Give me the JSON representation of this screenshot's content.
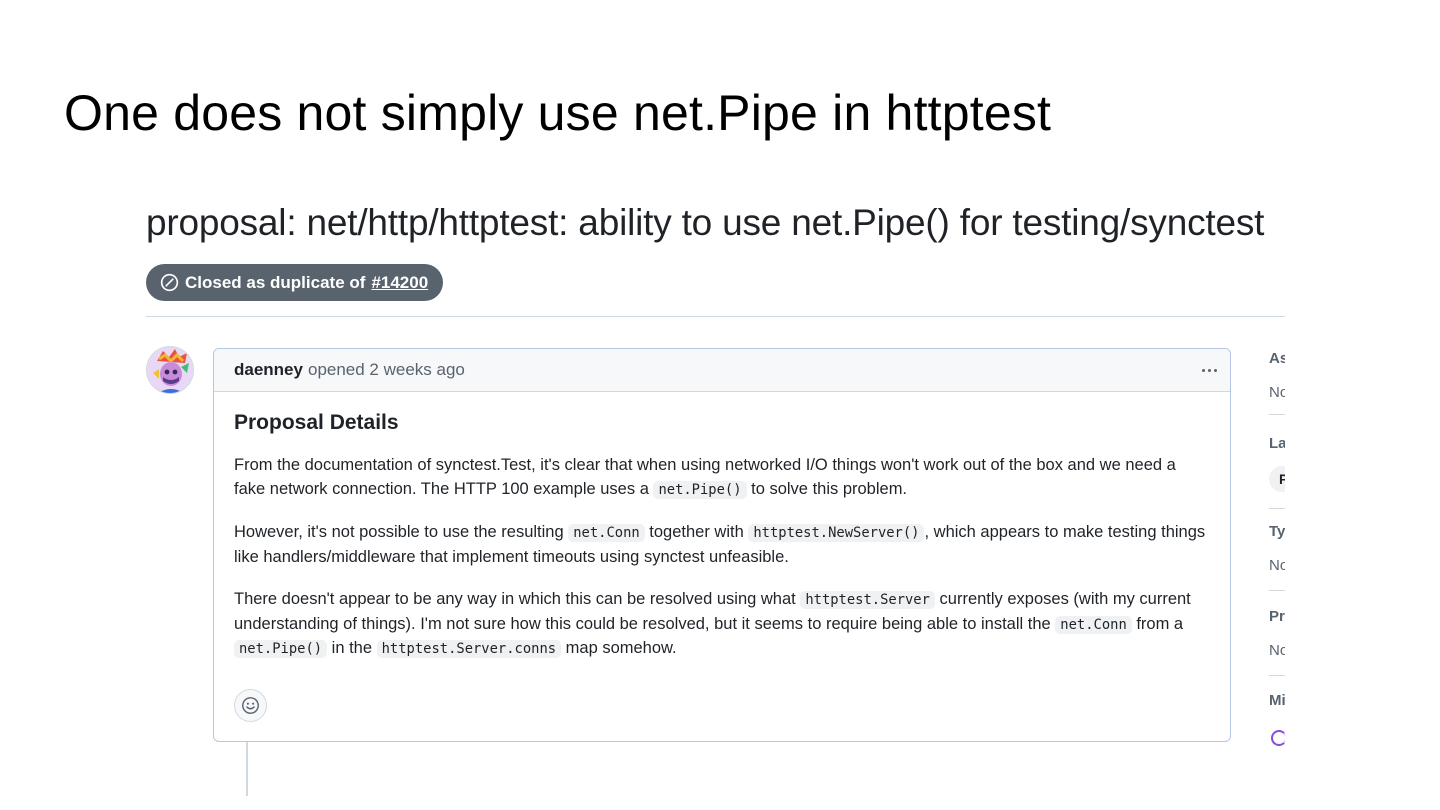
{
  "slide": {
    "title": "One does not simply use net.Pipe in httptest"
  },
  "issue": {
    "title": "proposal: net/http/httptest: ability to use net.Pipe() for testing/synctest",
    "state_label": "Closed as duplicate of",
    "duplicate_ref": "#14200"
  },
  "comment": {
    "author": "daenney",
    "timestamp": "opened 2 weeks ago",
    "heading": "Proposal Details",
    "p1": {
      "t1": "From the documentation of synctest.Test, it's clear that when using networked I/O things won't work out of the box and we need a fake network connection. The HTTP 100 example uses a ",
      "c1": "net.Pipe()",
      "t2": " to solve this problem."
    },
    "p2": {
      "t1": "However, it's not possible to use the resulting ",
      "c1": "net.Conn",
      "t2": " together with ",
      "c2": "httptest.NewServer()",
      "t3": ", which appears to make testing things like handlers/middleware that implement timeouts using synctest unfeasible."
    },
    "p3": {
      "t1": "There doesn't appear to be any way in which this can be resolved using what ",
      "c1": "httptest.Server",
      "t2": " currently exposes (with my current understanding of things). I'm not sure how this could be resolved, but it seems to require being able to install the ",
      "c2": "net.Conn",
      "t3": " from a ",
      "c3": "net.Pipe()",
      "t4": " in the ",
      "c4": "httptest.Server.conns",
      "t5": " map somehow."
    }
  },
  "sidebar": {
    "assignees_head": "As",
    "assignees_val": "No",
    "labels_head": "La",
    "label_chip": "P",
    "type_head": "Ty",
    "type_val": "No",
    "projects_head": "Pr",
    "projects_val": "No",
    "milestone_head": "Mi"
  },
  "colors": {
    "badge_bg": "#59636e",
    "border": "#d1d9e0",
    "comment_border": "#b6c7e6",
    "accent": "#8250df"
  },
  "icons": [
    "skip-icon",
    "avatar",
    "kebab-icon",
    "smiley-icon",
    "spinner-icon"
  ]
}
